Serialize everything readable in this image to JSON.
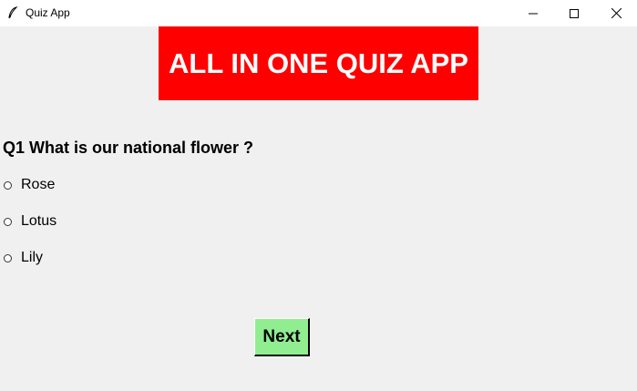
{
  "window": {
    "title": "Quiz App",
    "app_icon": "feather-icon",
    "controls": [
      "minimize-icon",
      "maximize-icon",
      "close-icon"
    ]
  },
  "banner": {
    "text": "ALL IN ONE QUIZ APP",
    "background": "#ff0000",
    "color": "#ffffff"
  },
  "question": {
    "text": "Q1 What is our national flower ?"
  },
  "options": [
    {
      "label": "Rose",
      "selected": false
    },
    {
      "label": "Lotus",
      "selected": false
    },
    {
      "label": "Lily",
      "selected": false
    }
  ],
  "next_button": {
    "label": "Next",
    "background": "#90ee90"
  }
}
